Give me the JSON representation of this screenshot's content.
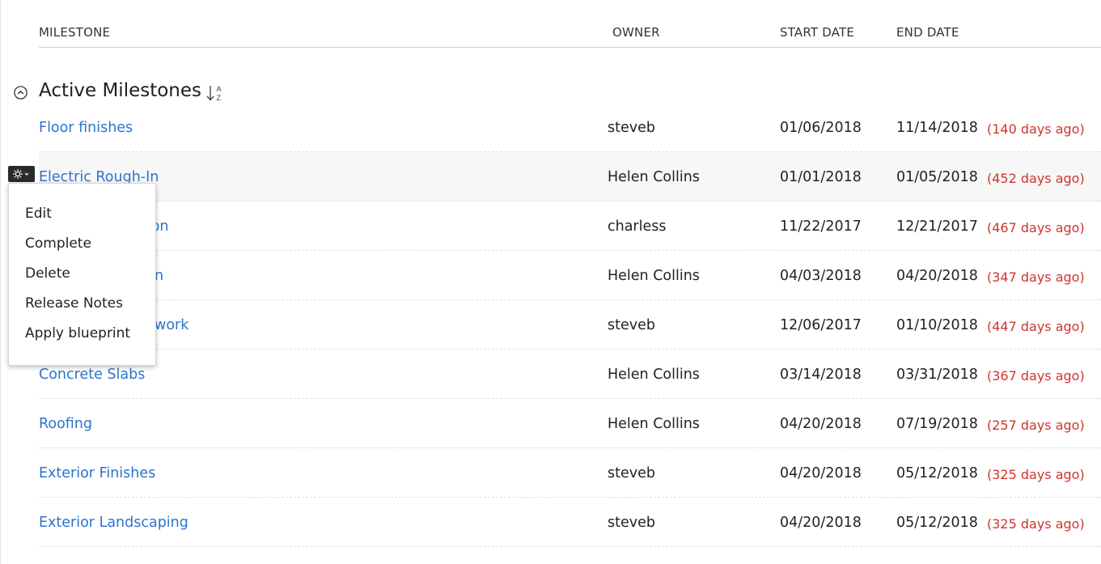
{
  "table": {
    "headers": {
      "milestone": "MILESTONE",
      "owner": "OWNER",
      "start_date": "START DATE",
      "end_date": "END DATE"
    }
  },
  "group": {
    "title": "Active Milestones",
    "sort_icon": "sort-alpha-icon",
    "collapse_icon": "chevron-up-circle-icon"
  },
  "rows": [
    {
      "name": "Floor finishes",
      "owner": "steveb",
      "start": "01/06/2018",
      "end": "11/14/2018",
      "ago": "(140 days ago)"
    },
    {
      "name": "Electric Rough-In",
      "owner": "Helen Collins",
      "start": "01/01/2018",
      "end": "01/05/2018",
      "ago": "(452 days ago)"
    },
    {
      "name": "tion",
      "owner": "charless",
      "start": "11/22/2017",
      "end": "12/21/2017",
      "ago": "(467 days ago)"
    },
    {
      "name": "n",
      "owner": "Helen Collins",
      "start": "04/03/2018",
      "end": "04/20/2018",
      "ago": "(347 days ago)"
    },
    {
      "name": "work",
      "owner": "steveb",
      "start": "12/06/2017",
      "end": "01/10/2018",
      "ago": "(447 days ago)"
    },
    {
      "name": "Concrete Slabs",
      "owner": "Helen Collins",
      "start": "03/14/2018",
      "end": "03/31/2018",
      "ago": "(367 days ago)"
    },
    {
      "name": "Roofing",
      "owner": "Helen Collins",
      "start": "04/20/2018",
      "end": "07/19/2018",
      "ago": "(257 days ago)"
    },
    {
      "name": "Exterior Finishes",
      "owner": "steveb",
      "start": "04/20/2018",
      "end": "05/12/2018",
      "ago": "(325 days ago)"
    },
    {
      "name": "Exterior Landscaping",
      "owner": "steveb",
      "start": "04/20/2018",
      "end": "05/12/2018",
      "ago": "(325 days ago)"
    }
  ],
  "context_menu": {
    "trigger_icon": "gear-icon",
    "items": [
      "Edit",
      "Complete",
      "Delete",
      "Release Notes",
      "Apply blueprint"
    ]
  },
  "colors": {
    "link": "#2c74cf",
    "overdue": "#d0342c",
    "text": "#222222"
  }
}
